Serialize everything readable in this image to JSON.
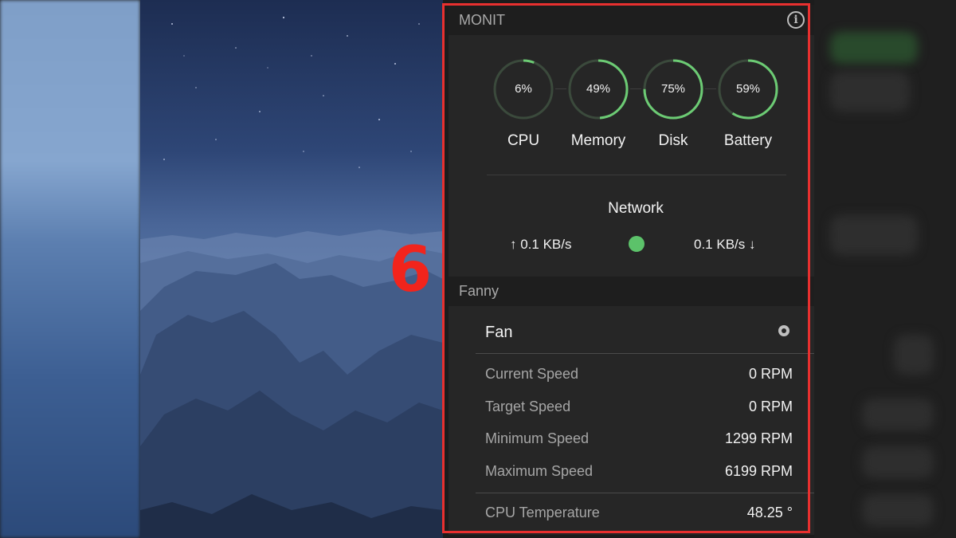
{
  "app": {
    "title": "MONIT"
  },
  "step_marker": "6",
  "gauges": [
    {
      "value_text": "6%",
      "percent": 6,
      "label": "CPU"
    },
    {
      "value_text": "49%",
      "percent": 49,
      "label": "Memory"
    },
    {
      "value_text": "75%",
      "percent": 75,
      "label": "Disk"
    },
    {
      "value_text": "59%",
      "percent": 59,
      "label": "Battery"
    }
  ],
  "network": {
    "title": "Network",
    "upload": "↑ 0.1 KB/s",
    "download": "0.1 KB/s ↓",
    "status_color": "#5cc26a"
  },
  "fanny": {
    "section_title": "Fanny",
    "fan_title": "Fan",
    "stats": [
      {
        "label": "Current Speed",
        "value": "0 RPM"
      },
      {
        "label": "Target Speed",
        "value": "0 RPM"
      },
      {
        "label": "Minimum Speed",
        "value": "1299 RPM"
      },
      {
        "label": "Maximum Speed",
        "value": "6199 RPM"
      }
    ],
    "temperature": {
      "label": "CPU Temperature",
      "value": "48.25 °"
    }
  },
  "colors": {
    "gauge_fill": "#6ccb74",
    "gauge_track": "#3b4a3c",
    "highlight_border": "#e8302f",
    "step_marker": "#f2241c"
  },
  "icons": {
    "info": "info-icon",
    "fan_toggle": "radio-icon"
  }
}
